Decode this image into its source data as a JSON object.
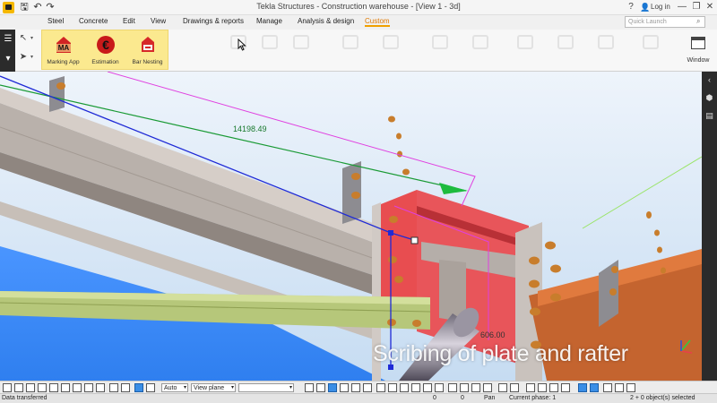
{
  "window": {
    "title": "Tekla Structures - Construction warehouse - [View 1 - 3d]",
    "help": "?",
    "login_label": "Log in",
    "minimize": "—",
    "restore": "❐",
    "close": "✕"
  },
  "quick_access": {
    "save_icon": "save-icon",
    "undo_icon": "undo-icon",
    "redo_icon": "redo-icon"
  },
  "menu": {
    "tabs": [
      "Steel",
      "Concrete",
      "Edit",
      "View",
      "Drawings & reports",
      "Manage",
      "Analysis & design",
      "Custom"
    ],
    "active_tab": "Custom",
    "quick_launch_placeholder": "Quick Launch"
  },
  "ribbon": {
    "custom_buttons": [
      {
        "label": "Marking App",
        "icon_text": "MA",
        "icon": "marking-app-icon"
      },
      {
        "label": "Estimation",
        "icon_text": "€",
        "icon": "estimation-icon"
      },
      {
        "label": "Bar Nesting",
        "icon_text": "",
        "icon": "bar-nesting-icon"
      }
    ],
    "window_label": "Window"
  },
  "viewport": {
    "dimension_main": "14198.49",
    "dimension_secondary": "606.00",
    "caption": "Scribing of plate and rafter"
  },
  "bottom_toolbar": {
    "snap_select": "Auto",
    "plane_select": "View plane"
  },
  "status": {
    "left": "Data transferred",
    "coord_x": "0",
    "coord_y": "0",
    "mode": "Pan",
    "phase": "Current phase: 1",
    "selection": "2 + 0 object(s) selected"
  },
  "colors": {
    "accent": "#f0a000",
    "plate_red": "#e8504f",
    "beam_gray": "#b8afa8",
    "rafter_orange": "#c8652e",
    "tube_green": "#b6c77a",
    "bolt": "#c87d2c",
    "dim_green": "#1a7a2e",
    "sky_top": "#e8f1fb",
    "ground": "#3d8cff"
  }
}
